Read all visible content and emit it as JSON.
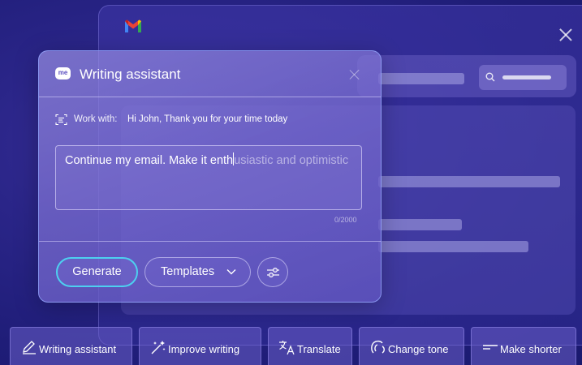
{
  "background_window": {
    "logo": "gmail-icon",
    "close_icon": "close-icon",
    "search_icon": "search-icon"
  },
  "dialog": {
    "badge": "me",
    "title": "Writing assistant",
    "close_icon": "close-icon",
    "work_with_label": "Work with:",
    "work_with_value": "Hi John, Thank you for your time today",
    "prompt_typed": "Continue my email. Make it enth",
    "prompt_suggestion": "usiastic and optimistic",
    "char_count": "0/2000",
    "generate_label": "Generate",
    "templates_label": "Templates",
    "settings_icon": "sliders-icon"
  },
  "toolbar": {
    "items": [
      {
        "label": "Writing assistant",
        "icon": "pencil-icon"
      },
      {
        "label": "Improve writing",
        "icon": "magic-wand-icon"
      },
      {
        "label": "Translate",
        "icon": "translate-icon"
      },
      {
        "label": "Change tone",
        "icon": "tone-icon"
      },
      {
        "label": "Make shorter",
        "icon": "shorten-icon"
      }
    ]
  },
  "colors": {
    "background": "#231f80",
    "accent_border": "#4dd0f0",
    "dialog": "#7a6ccd"
  }
}
